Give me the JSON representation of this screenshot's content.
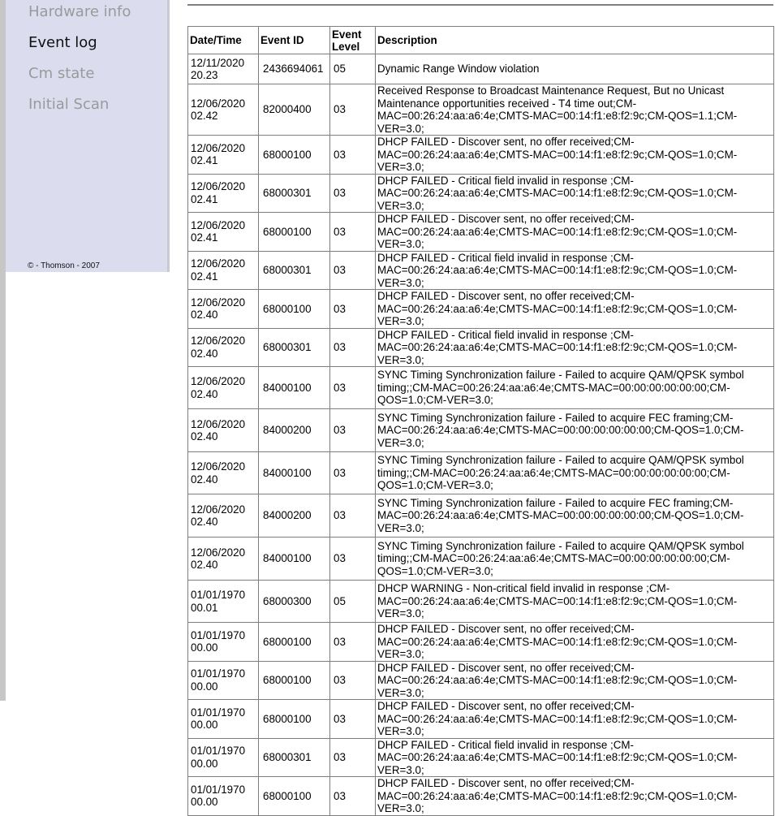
{
  "sidebar": {
    "items": [
      {
        "label": "Hardware info",
        "active": false
      },
      {
        "label": "Event log",
        "active": true
      },
      {
        "label": "Cm state",
        "active": false
      },
      {
        "label": "Initial Scan",
        "active": false
      }
    ],
    "copyright": "© - Thomson - 2007"
  },
  "table": {
    "columns": [
      "Date/Time",
      "Event ID",
      "Event Level",
      "Description"
    ],
    "rows": [
      {
        "datetime": "12/11/2020 20.23",
        "id": "2436694061",
        "level": "05",
        "desc": "Dynamic Range Window violation"
      },
      {
        "datetime": "12/06/2020 02.42",
        "id": "82000400",
        "level": "03",
        "desc": "Received Response to Broadcast Maintenance Request, But no Unicast Maintenance opportunities received - T4 time out;CM-MAC=00:26:24:aa:a6:4e;CMTS-MAC=00:14:f1:e8:f2:9c;CM-QOS=1.1;CM-VER=3.0;"
      },
      {
        "datetime": "12/06/2020 02.41",
        "id": "68000100",
        "level": "03",
        "desc": "DHCP FAILED - Discover sent, no offer received;CM-MAC=00:26:24:aa:a6:4e;CMTS-MAC=00:14:f1:e8:f2:9c;CM-QOS=1.0;CM-VER=3.0;"
      },
      {
        "datetime": "12/06/2020 02.41",
        "id": "68000301",
        "level": "03",
        "desc": "DHCP FAILED - Critical field invalid in response ;CM-MAC=00:26:24:aa:a6:4e;CMTS-MAC=00:14:f1:e8:f2:9c;CM-QOS=1.0;CM-VER=3.0;"
      },
      {
        "datetime": "12/06/2020 02.41",
        "id": "68000100",
        "level": "03",
        "desc": "DHCP FAILED - Discover sent, no offer received;CM-MAC=00:26:24:aa:a6:4e;CMTS-MAC=00:14:f1:e8:f2:9c;CM-QOS=1.0;CM-VER=3.0;"
      },
      {
        "datetime": "12/06/2020 02.41",
        "id": "68000301",
        "level": "03",
        "desc": "DHCP FAILED - Critical field invalid in response ;CM-MAC=00:26:24:aa:a6:4e;CMTS-MAC=00:14:f1:e8:f2:9c;CM-QOS=1.0;CM-VER=3.0;"
      },
      {
        "datetime": "12/06/2020 02.40",
        "id": "68000100",
        "level": "03",
        "desc": "DHCP FAILED - Discover sent, no offer received;CM-MAC=00:26:24:aa:a6:4e;CMTS-MAC=00:14:f1:e8:f2:9c;CM-QOS=1.0;CM-VER=3.0;"
      },
      {
        "datetime": "12/06/2020 02.40",
        "id": "68000301",
        "level": "03",
        "desc": "DHCP FAILED - Critical field invalid in response ;CM-MAC=00:26:24:aa:a6:4e;CMTS-MAC=00:14:f1:e8:f2:9c;CM-QOS=1.0;CM-VER=3.0;"
      },
      {
        "datetime": "12/06/2020 02.40",
        "id": "84000100",
        "level": "03",
        "desc": "SYNC Timing Synchronization failure - Failed to acquire QAM/QPSK symbol timing;;CM-MAC=00:26:24:aa:a6:4e;CMTS-MAC=00:00:00:00:00:00;CM-QOS=1.0;CM-VER=3.0;"
      },
      {
        "datetime": "12/06/2020 02.40",
        "id": "84000200",
        "level": "03",
        "desc": "SYNC Timing Synchronization failure - Failed to acquire FEC framing;CM-MAC=00:26:24:aa:a6:4e;CMTS-MAC=00:00:00:00:00:00;CM-QOS=1.0;CM-VER=3.0;"
      },
      {
        "datetime": "12/06/2020 02.40",
        "id": "84000100",
        "level": "03",
        "desc": "SYNC Timing Synchronization failure - Failed to acquire QAM/QPSK symbol timing;;CM-MAC=00:26:24:aa:a6:4e;CMTS-MAC=00:00:00:00:00:00;CM-QOS=1.0;CM-VER=3.0;"
      },
      {
        "datetime": "12/06/2020 02.40",
        "id": "84000200",
        "level": "03",
        "desc": "SYNC Timing Synchronization failure - Failed to acquire FEC framing;CM-MAC=00:26:24:aa:a6:4e;CMTS-MAC=00:00:00:00:00:00;CM-QOS=1.0;CM-VER=3.0;"
      },
      {
        "datetime": "12/06/2020 02.40",
        "id": "84000100",
        "level": "03",
        "desc": "SYNC Timing Synchronization failure - Failed to acquire QAM/QPSK symbol timing;;CM-MAC=00:26:24:aa:a6:4e;CMTS-MAC=00:00:00:00:00:00;CM-QOS=1.0;CM-VER=3.0;"
      },
      {
        "datetime": "01/01/1970 00.01",
        "id": "68000300",
        "level": "05",
        "desc": "DHCP WARNING - Non-critical field invalid in response ;CM-MAC=00:26:24:aa:a6:4e;CMTS-MAC=00:14:f1:e8:f2:9c;CM-QOS=1.0;CM-VER=3.0;"
      },
      {
        "datetime": "01/01/1970 00.00",
        "id": "68000100",
        "level": "03",
        "desc": "DHCP FAILED - Discover sent, no offer received;CM-MAC=00:26:24:aa:a6:4e;CMTS-MAC=00:14:f1:e8:f2:9c;CM-QOS=1.0;CM-VER=3.0;"
      },
      {
        "datetime": "01/01/1970 00.00",
        "id": "68000100",
        "level": "03",
        "desc": "DHCP FAILED - Discover sent, no offer received;CM-MAC=00:26:24:aa:a6:4e;CMTS-MAC=00:14:f1:e8:f2:9c;CM-QOS=1.0;CM-VER=3.0;"
      },
      {
        "datetime": "01/01/1970 00.00",
        "id": "68000100",
        "level": "03",
        "desc": "DHCP FAILED - Discover sent, no offer received;CM-MAC=00:26:24:aa:a6:4e;CMTS-MAC=00:14:f1:e8:f2:9c;CM-QOS=1.0;CM-VER=3.0;"
      },
      {
        "datetime": "01/01/1970 00.00",
        "id": "68000301",
        "level": "03",
        "desc": "DHCP FAILED - Critical field invalid in response ;CM-MAC=00:26:24:aa:a6:4e;CMTS-MAC=00:14:f1:e8:f2:9c;CM-QOS=1.0;CM-VER=3.0;"
      },
      {
        "datetime": "01/01/1970 00.00",
        "id": "68000100",
        "level": "03",
        "desc": "DHCP FAILED - Discover sent, no offer received;CM-MAC=00:26:24:aa:a6:4e;CMTS-MAC=00:14:f1:e8:f2:9c;CM-QOS=1.0;CM-VER=3.0;"
      }
    ]
  }
}
